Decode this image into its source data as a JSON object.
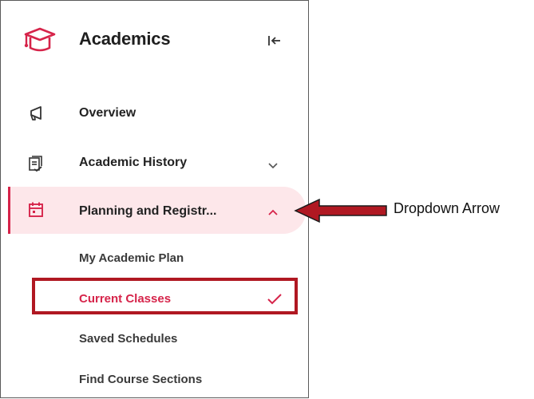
{
  "header": {
    "title": "Academics",
    "app_icon": "graduation-cap-icon",
    "collapse_icon": "collapse-sidebar-icon"
  },
  "nav": {
    "items": [
      {
        "label": "Overview",
        "icon": "megaphone-icon"
      },
      {
        "label": "Academic History",
        "icon": "document-check-icon",
        "chevron": "chevron-down-icon"
      },
      {
        "label": "Planning and Registr...",
        "icon": "calendar-icon",
        "chevron": "chevron-up-icon",
        "active": true
      }
    ],
    "subitems": [
      {
        "label": "My Academic Plan"
      },
      {
        "label": "Current Classes",
        "selected": true,
        "icon": "check-icon"
      },
      {
        "label": "Saved Schedules"
      },
      {
        "label": "Find Course Sections"
      }
    ]
  },
  "annotation": {
    "label": "Dropdown Arrow"
  },
  "colors": {
    "accent": "#d6244a",
    "active_bg": "#fde7ea",
    "highlight_box": "#b01822",
    "arrow": "#b01822"
  }
}
